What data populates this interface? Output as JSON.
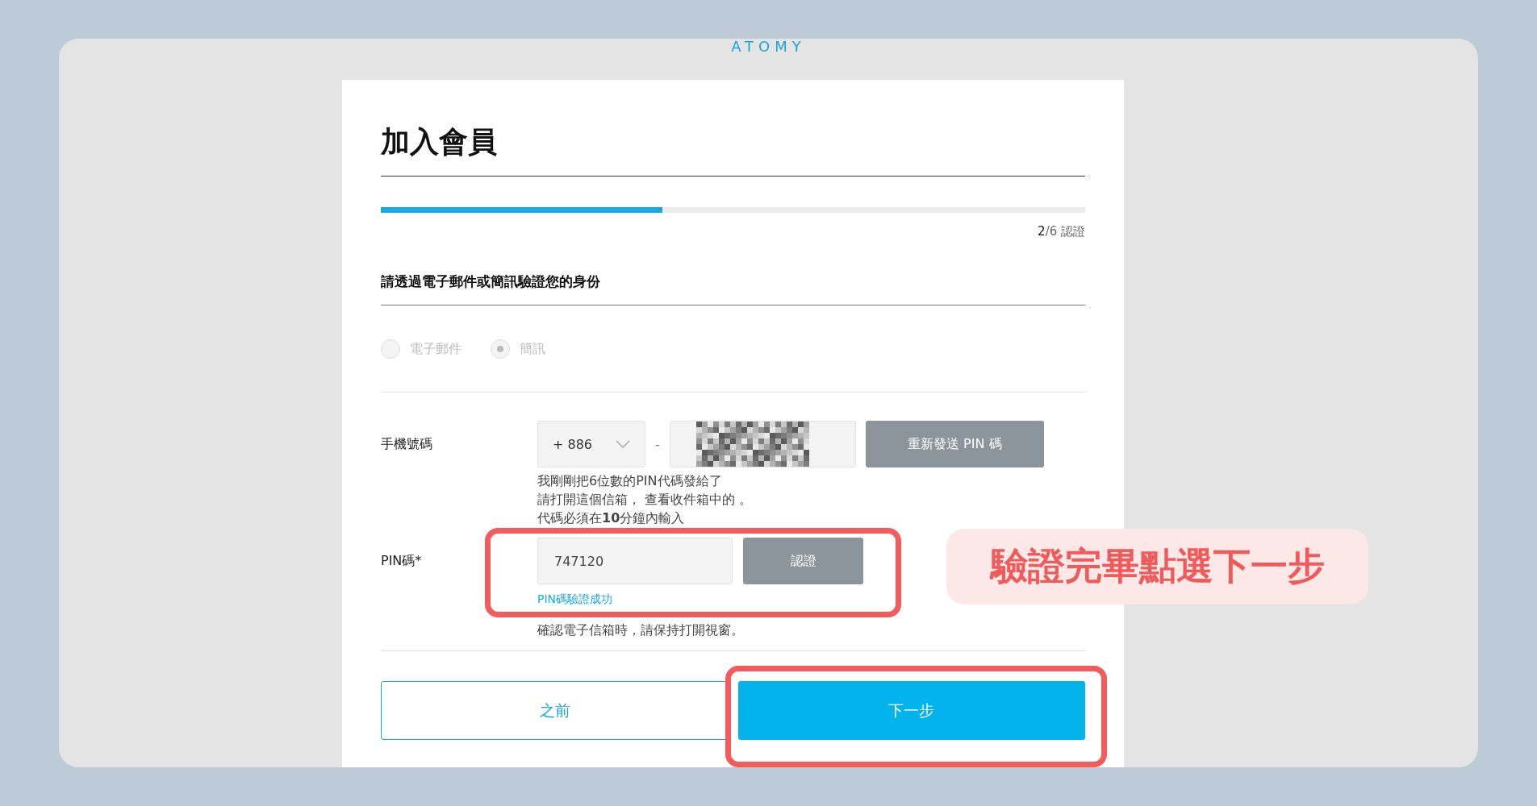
{
  "logo": "ATOMY",
  "title": "加入會員",
  "progress": {
    "level": 0.4,
    "step_current": "2",
    "step_total": "/6",
    "step_label": "認證"
  },
  "heading": "請透過電子郵件或簡訊驗證您的身份",
  "methods": [
    {
      "label": "電子郵件",
      "selected": false,
      "disabled": true
    },
    {
      "label": "簡訊",
      "selected": true,
      "disabled": true
    }
  ],
  "phone": {
    "label": "手機號碼",
    "country_code": "+ 886",
    "separator": "-",
    "resend_button": "重新發送 PIN 碼",
    "help": [
      "我剛剛把6位數的PIN代碼發給了",
      "請打開這個信箱， 查看收件箱中的 。",
      "代碼必須在**10**分鐘內輸入"
    ]
  },
  "pin": {
    "label": "PIN碼*",
    "value": "747120",
    "verify_button": "認證",
    "verified": true,
    "success": "PIN碼驗證成功",
    "note": "確認電子信箱時，請保持打開視窗。"
  },
  "buttons": {
    "back": "之前",
    "next": "下一步"
  },
  "callout": "驗證完畢點選下一步"
}
